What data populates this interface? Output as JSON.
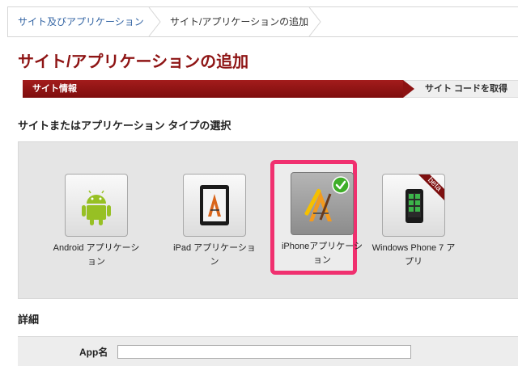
{
  "breadcrumb": {
    "items": [
      {
        "label": "サイト及びアプリケーション"
      },
      {
        "label": "サイト/アプリケーションの追加"
      }
    ]
  },
  "page": {
    "title": "サイト/アプリケーションの追加"
  },
  "steps": [
    {
      "label": "サイト情報",
      "active": true
    },
    {
      "label": "サイト コードを取得",
      "active": false
    }
  ],
  "type_section": {
    "title": "サイトまたはアプリケーション タイプの選択",
    "options": [
      {
        "label": "Android アプリケーション",
        "icon": "android-robot-icon",
        "selected": false
      },
      {
        "label": "iPad アプリケーション",
        "icon": "ipad-app-icon",
        "selected": false
      },
      {
        "label": "iPhoneアプリケーション",
        "icon": "iphone-app-icon",
        "selected": true
      },
      {
        "label": "Windows Phone 7 アプリ",
        "icon": "windows-phone-icon",
        "selected": false,
        "badge": "beta"
      }
    ],
    "selected_check_icon": "checkmark-icon"
  },
  "details": {
    "title": "詳細",
    "app_name_label": "App名",
    "app_name_value": ""
  },
  "colors": {
    "title_red": "#8e1414",
    "step_active": "#8c1212",
    "highlight": "#f0306f",
    "link_blue": "#3465a4",
    "check_green": "#3fae29",
    "android_green": "#97c024"
  }
}
